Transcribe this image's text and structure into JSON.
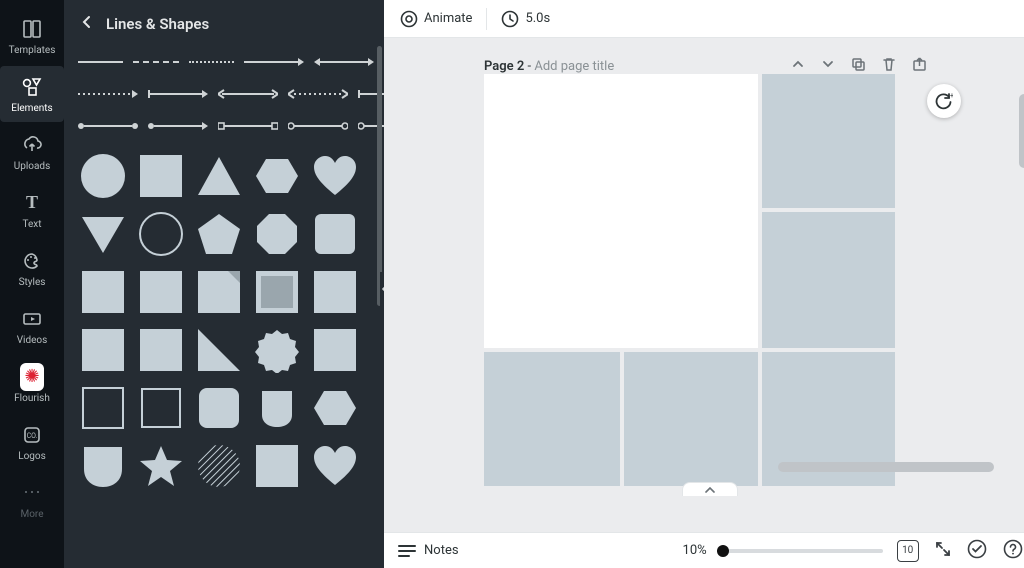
{
  "rail": {
    "items": [
      {
        "id": "templates",
        "label": "Templates"
      },
      {
        "id": "elements",
        "label": "Elements"
      },
      {
        "id": "uploads",
        "label": "Uploads"
      },
      {
        "id": "text",
        "label": "Text"
      },
      {
        "id": "styles",
        "label": "Styles"
      },
      {
        "id": "videos",
        "label": "Videos"
      },
      {
        "id": "flourish",
        "label": "Flourish"
      },
      {
        "id": "logos",
        "label": "Logos"
      },
      {
        "id": "more",
        "label": "More"
      }
    ],
    "active": "elements"
  },
  "panel": {
    "title": "Lines & Shapes"
  },
  "topbar": {
    "animate": "Animate",
    "duration": "5.0s"
  },
  "page": {
    "label": "Page 2",
    "sep": " - ",
    "placeholder": "Add page title"
  },
  "bottom": {
    "notes": "Notes",
    "zoom": "10%",
    "grid_count": "10"
  }
}
